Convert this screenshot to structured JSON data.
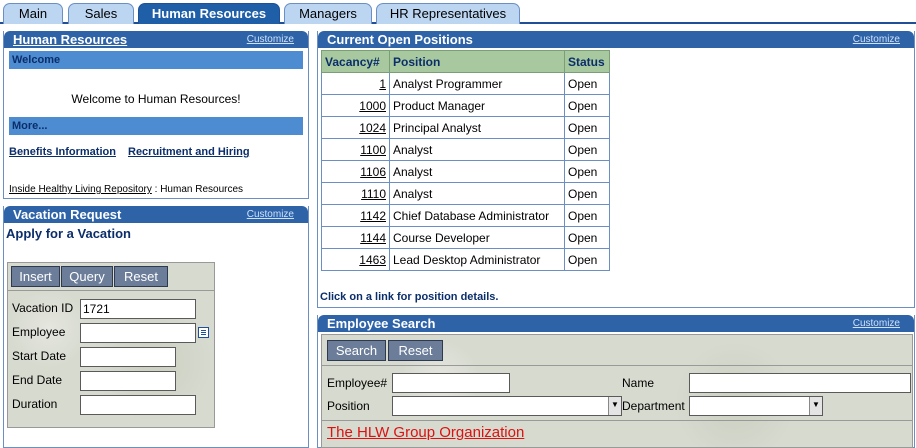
{
  "tabs": [
    {
      "label": "Main"
    },
    {
      "label": "Sales"
    },
    {
      "label": "Human Resources"
    },
    {
      "label": "Managers"
    },
    {
      "label": "HR Representatives"
    }
  ],
  "hr": {
    "title": "Human Resources",
    "customize": "Customize",
    "welcome_bar": "Welcome",
    "welcome_text": "Welcome to Human Resources!",
    "more_bar": "More...",
    "link_benefits": "Benefits Information",
    "link_recruitment": "Recruitment and Hiring",
    "breadcrumb_link": "Inside Healthy Living Repository",
    "breadcrumb_sep": ":",
    "breadcrumb_current": "Human Resources"
  },
  "vacation": {
    "title": "Vacation Request",
    "customize": "Customize",
    "subtitle": "Apply for a Vacation",
    "btn_insert": "Insert",
    "btn_query": "Query",
    "btn_reset": "Reset",
    "label_vacation_id": "Vacation ID",
    "value_vacation_id": "1721",
    "label_employee": "Employee",
    "value_employee": "",
    "label_start_date": "Start Date",
    "value_start_date": "",
    "label_end_date": "End Date",
    "value_end_date": "",
    "label_duration": "Duration",
    "value_duration": ""
  },
  "positions": {
    "title": "Current Open Positions",
    "customize": "Customize",
    "headers": [
      "Vacancy#",
      "Position",
      "Status"
    ],
    "rows": [
      {
        "vacancy": "1",
        "position": "Analyst Programmer",
        "status": "Open"
      },
      {
        "vacancy": "1000",
        "position": "Product Manager",
        "status": "Open"
      },
      {
        "vacancy": "1024",
        "position": "Principal Analyst",
        "status": "Open"
      },
      {
        "vacancy": "1100",
        "position": "Analyst",
        "status": "Open"
      },
      {
        "vacancy": "1106",
        "position": "Analyst",
        "status": "Open"
      },
      {
        "vacancy": "1110",
        "position": "Analyst",
        "status": "Open"
      },
      {
        "vacancy": "1142",
        "position": "Chief Database Administrator",
        "status": "Open"
      },
      {
        "vacancy": "1144",
        "position": "Course Developer",
        "status": "Open"
      },
      {
        "vacancy": "1463",
        "position": "Lead Desktop Administrator",
        "status": "Open"
      }
    ],
    "note": "Click on a link for position details."
  },
  "search": {
    "title": "Employee Search",
    "customize": "Customize",
    "btn_search": "Search",
    "btn_reset": "Reset",
    "label_employee_no": "Employee#",
    "value_employee_no": "",
    "label_name": "Name",
    "value_name": "",
    "label_position": "Position",
    "value_position": "",
    "label_department": "Department",
    "value_department": "",
    "org_link": "The HLW Group Organization"
  },
  "colors": {
    "accent": "#2e63a8",
    "tab_active": "#1f5fa8",
    "tab_inactive": "#bcd6f2",
    "subbar": "#4d8cd1",
    "link_red": "#dd1111"
  }
}
